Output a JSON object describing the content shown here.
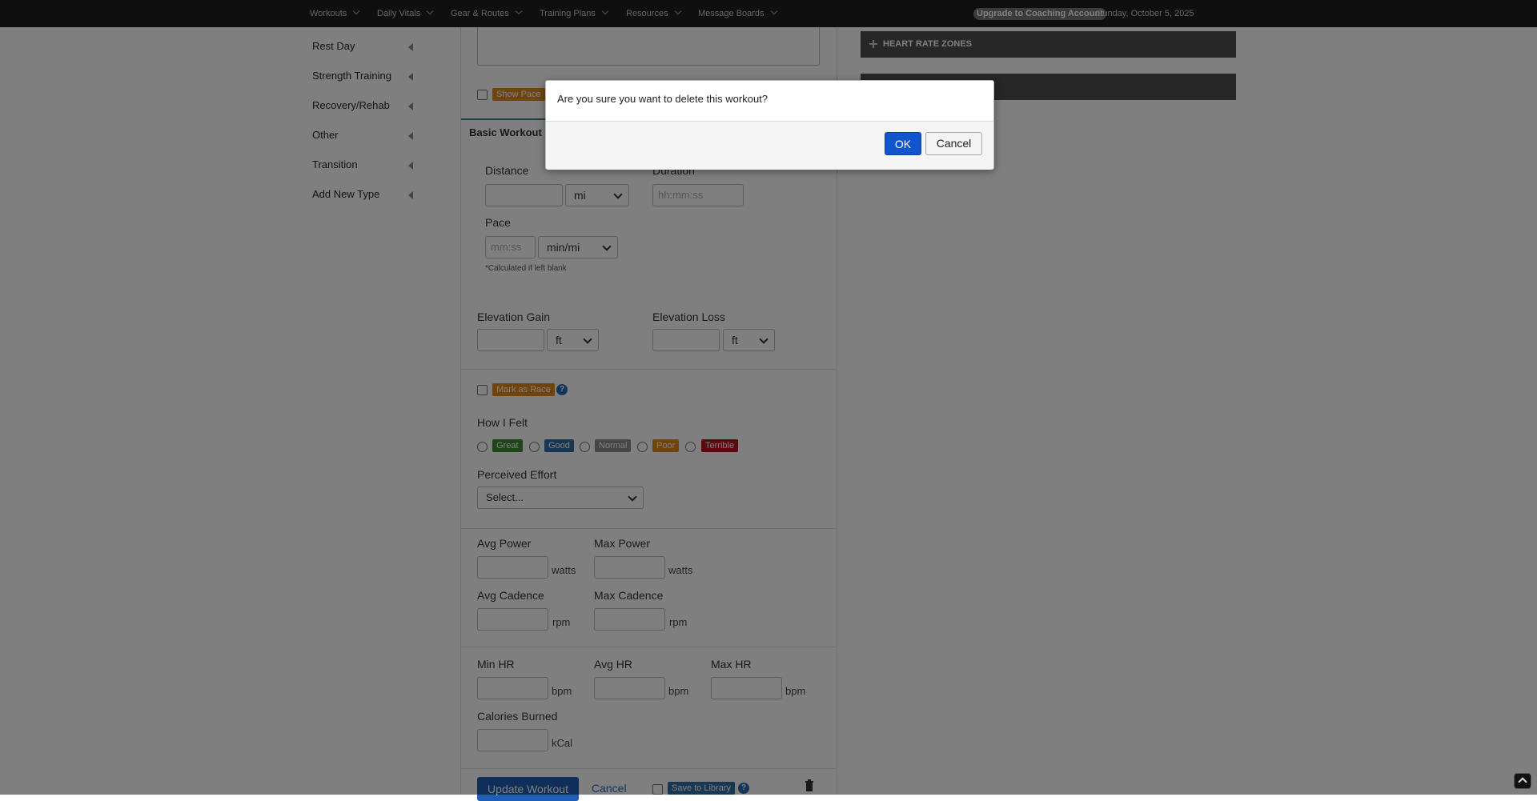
{
  "nav": {
    "items": [
      "Workouts",
      "Daily Vitals",
      "Gear & Routes",
      "Training Plans",
      "Resources",
      "Message Boards"
    ],
    "upgrade": "Upgrade to Coaching Account",
    "date": "Sunday, October 5, 2025"
  },
  "sidebar": {
    "items": [
      "Rest Day",
      "Strength Training",
      "Recovery/Rehab",
      "Other",
      "Transition",
      "Add New Type"
    ]
  },
  "form": {
    "show_pace_tag": "Show Pace",
    "tab_basic": "Basic Workout",
    "distance_label": "Distance",
    "distance_unit": "mi",
    "duration_label": "Duration",
    "duration_placeholder": "hh:mm:ss",
    "pace_label": "Pace",
    "pace_placeholder": "mm:ss",
    "pace_unit": "min/mi",
    "calc_note": "*Calculated if left blank",
    "elev_gain_label": "Elevation Gain",
    "elev_gain_unit": "ft",
    "elev_loss_label": "Elevation Loss",
    "elev_loss_unit": "ft",
    "race_tag": "Mark as Race",
    "felt_label": "How I Felt",
    "felt_options": [
      {
        "label": "Great",
        "color": "#3c8a2e"
      },
      {
        "label": "Good",
        "color": "#2f6ea5"
      },
      {
        "label": "Normal",
        "color": "#8a8a8a"
      },
      {
        "label": "Poor",
        "color": "#e08a1a"
      },
      {
        "label": "Terrible",
        "color": "#b3141c"
      }
    ],
    "effort_label": "Perceived Effort",
    "effort_value": "Select...",
    "avg_power_label": "Avg Power",
    "max_power_label": "Max Power",
    "watts": "watts",
    "avg_cadence_label": "Avg Cadence",
    "max_cadence_label": "Max Cadence",
    "rpm": "rpm",
    "min_hr_label": "Min HR",
    "avg_hr_label": "Avg HR",
    "max_hr_label": "Max HR",
    "bpm": "bpm",
    "calories_label": "Calories Burned",
    "kcal": "kCal",
    "update_button": "Update Workout",
    "cancel_link": "Cancel",
    "save_library_tag": "Save to Library"
  },
  "right": {
    "hr_zones": "HEART RATE ZONES"
  },
  "dialog": {
    "message": "Are you sure you want to delete this workout?",
    "ok": "OK",
    "cancel": "Cancel"
  },
  "colors": {
    "nav_bg": "#1f1f1f",
    "ok_blue": "#1155cc",
    "tag_orange": "#e08a1a",
    "tag_blue": "#2f6ea5"
  }
}
